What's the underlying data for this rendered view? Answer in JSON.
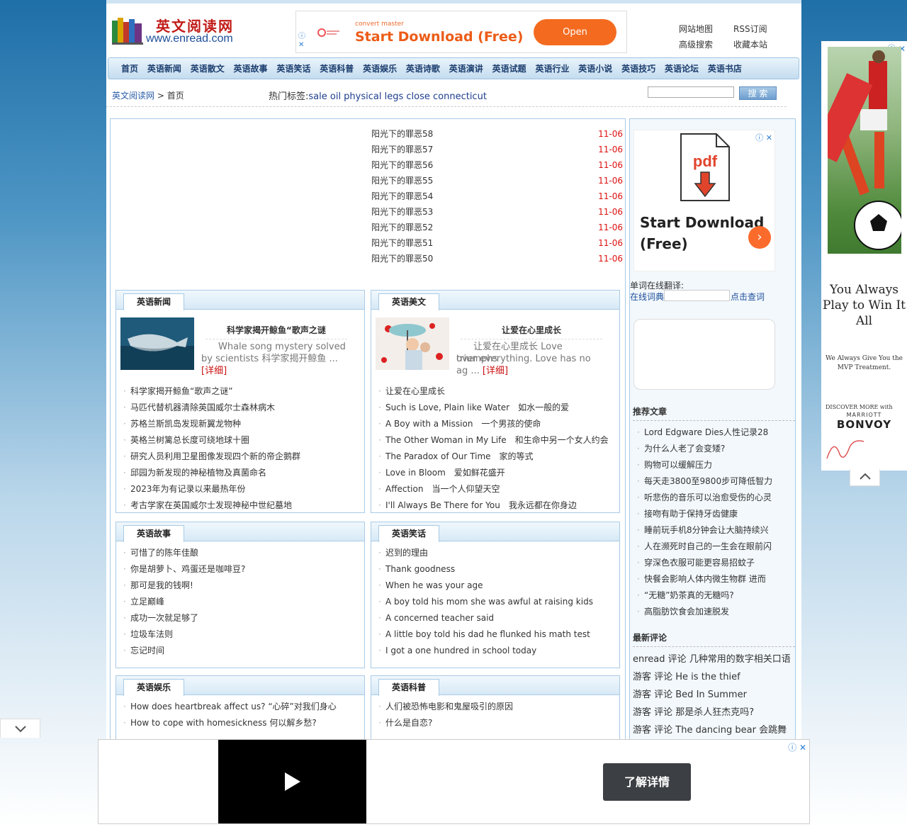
{
  "header": {
    "logo_cn": "英文阅读网",
    "logo_en": "www.enread.com",
    "ad": {
      "brand": "convert master",
      "title": "Start Download (Free)",
      "button": "Open"
    },
    "links": [
      "网站地图",
      "RSS订阅",
      "高级搜索",
      "收藏本站"
    ]
  },
  "nav": [
    "首页",
    "英语新闻",
    "英语散文",
    "英语故事",
    "英语笑话",
    "英语科普",
    "英语娱乐",
    "英语诗歌",
    "英语演讲",
    "英语试题",
    "英语行业",
    "英语小说",
    "英语技巧",
    "英语论坛",
    "英语书店"
  ],
  "crumb": {
    "home": "英文阅读网",
    "sep": ">",
    "current": "首页"
  },
  "hot": {
    "label": "热门标签:",
    "tags": "sale oil physical legs close connecticut"
  },
  "search": {
    "button": "搜 索"
  },
  "top_list": [
    {
      "title": "阳光下的罪恶58",
      "date": "11-06"
    },
    {
      "title": "阳光下的罪恶57",
      "date": "11-06"
    },
    {
      "title": "阳光下的罪恶56",
      "date": "11-06"
    },
    {
      "title": "阳光下的罪恶55",
      "date": "11-06"
    },
    {
      "title": "阳光下的罪恶54",
      "date": "11-06"
    },
    {
      "title": "阳光下的罪恶53",
      "date": "11-06"
    },
    {
      "title": "阳光下的罪恶52",
      "date": "11-06"
    },
    {
      "title": "阳光下的罪恶51",
      "date": "11-06"
    },
    {
      "title": "阳光下的罪恶50",
      "date": "11-06"
    }
  ],
  "boxes": {
    "news": {
      "title": "英语新闻",
      "feat_title": "科学家揭开鲸鱼“歌声之谜",
      "feat_desc1": "Whale song mystery solved",
      "feat_desc2": "by scientists 科学家揭开鲸鱼 ...",
      "more": "[详细]",
      "items": [
        "科学家揭开鲸鱼“歌声之谜”",
        "马匹代替机器清除英国威尔士森林病木",
        "苏格兰斯凯岛发现新翼龙物种",
        "英格兰树篱总长度可绕地球十圈",
        "研究人员利用卫星图像发现四个新的帝企鹅群",
        "邱园为新发现的神秘植物及真菌命名",
        "2023年为有记录以来最热年份",
        "考古学家在英国威尔士发现神秘中世纪墓地"
      ]
    },
    "essay": {
      "title": "英语美文",
      "feat_title": "让爱在心里成长",
      "feat_desc1": "让爱在心里成长 Love triumphs",
      "feat_desc2": "over everything. Love has no",
      "feat_desc3": "ag ...",
      "more": "[详细]",
      "items": [
        "让爱在心里成长",
        "Such is Love, Plain like Water　如水一般的爱",
        "A Boy with a Mission　一个男孩的使命",
        "The Other Woman in My Life　和生命中另一个女人约会",
        "The Paradox of Our Time　家的等式",
        "Love in Bloom　爱如鲜花盛开",
        "Affection　当一个人仰望天空",
        "I'll Always Be There for You　我永远都在你身边"
      ]
    },
    "story": {
      "title": "英语故事",
      "items": [
        "可惜了的陈年佳酿",
        "你是胡萝卜、鸡蛋还是咖啡豆?",
        "那可是我的钱啊!",
        "立足巅峰",
        "成功一次就足够了",
        "垃圾车法则",
        "忘记时间"
      ]
    },
    "joke": {
      "title": "英语笑话",
      "items": [
        "迟到的理由",
        "Thank goodness",
        "When he was your age",
        "A boy told his mom she was awful at raising kids",
        "A concerned teacher said",
        "A little boy told his dad he flunked his math test",
        "I got a one hundred in school today"
      ]
    },
    "ent": {
      "title": "英语娱乐",
      "items": [
        "How does heartbreak affect us? “心碎”对我们身心",
        "How to cope with homesickness 何以解乡愁?"
      ]
    },
    "sci": {
      "title": "英语科普",
      "items": [
        "人们被恐怖电影和鬼屋吸引的原因",
        "什么是自恋?"
      ]
    }
  },
  "side": {
    "ad_title": "Start Download (Free)",
    "dict_label": "单词在线翻译:",
    "dict_link": "在线词典",
    "dict_query": "点击查词",
    "rec_title": "推荐文章",
    "rec_items": [
      "Lord Edgware Dies人性记录28",
      "为什么人老了会变矮?",
      "购物可以缓解压力",
      "每天走3800至9800步可降低智力",
      "听悲伤的音乐可以治愈受伤的心灵",
      "接吻有助于保持牙齿健康",
      "睡前玩手机8分钟会让大脑持续兴",
      "人在濒死时自己的一生会在眼前闪",
      "穿深色衣服可能更容易招蚊子",
      "快餐会影响人体内微生物群 进而",
      "“无糖”奶茶真的无糖吗?",
      "高脂肪饮食会加速脱发"
    ],
    "cm_title": "最新评论",
    "cm_items": [
      "enread 评论 几种常用的数字相关口语",
      "游客 评论 He is the thief",
      "游客 评论 Bed In Summer",
      "游客 评论 那是杀人狂杰克吗?",
      "游客 评论 The dancing bear 会跳舞"
    ]
  },
  "right_ad": {
    "slogan": "You Always Play to Win It All",
    "sub": "We Always Give You the MVP Treatment.",
    "disc": "DISCOVER MORE with",
    "brand1": "MARRIOTT",
    "brand2": "BONVOY"
  },
  "bottom_ad": {
    "cta": "了解详情"
  }
}
